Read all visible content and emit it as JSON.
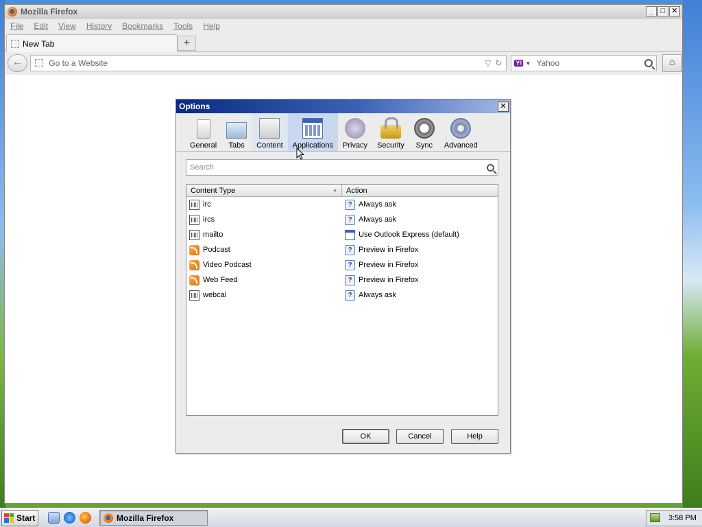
{
  "window": {
    "title": "Mozilla Firefox",
    "controls": {
      "minimize": "_",
      "maximize": "□",
      "close": "✕"
    }
  },
  "menubar": [
    "File",
    "Edit",
    "View",
    "History",
    "Bookmarks",
    "Tools",
    "Help"
  ],
  "tabs": [
    {
      "label": "New Tab"
    }
  ],
  "new_tab_button": "+",
  "navbar": {
    "url_placeholder": "Go to a Website",
    "search_engine": "Yahoo",
    "search_badge": "Y!"
  },
  "dialog": {
    "title": "Options",
    "close": "✕",
    "panes": [
      {
        "label": "General",
        "icon": "general-icon"
      },
      {
        "label": "Tabs",
        "icon": "tabs-icon"
      },
      {
        "label": "Content",
        "icon": "content-icon",
        "state": "hover"
      },
      {
        "label": "Applications",
        "icon": "applications-icon",
        "state": "selected"
      },
      {
        "label": "Privacy",
        "icon": "privacy-mask-icon"
      },
      {
        "label": "Security",
        "icon": "security-lock-icon"
      },
      {
        "label": "Sync",
        "icon": "sync-icon"
      },
      {
        "label": "Advanced",
        "icon": "advanced-gear-icon"
      }
    ],
    "search_placeholder": "Search",
    "columns": {
      "content_type": "Content Type",
      "action": "Action"
    },
    "rows": [
      {
        "type": "irc",
        "type_icon": "protocol",
        "action": "Always ask",
        "action_icon": "ask"
      },
      {
        "type": "ircs",
        "type_icon": "protocol",
        "action": "Always ask",
        "action_icon": "ask"
      },
      {
        "type": "mailto",
        "type_icon": "protocol",
        "action": "Use Outlook Express (default)",
        "action_icon": "app"
      },
      {
        "type": "Podcast",
        "type_icon": "feed",
        "action": "Preview in Firefox",
        "action_icon": "ask"
      },
      {
        "type": "Video Podcast",
        "type_icon": "feed",
        "action": "Preview in Firefox",
        "action_icon": "ask"
      },
      {
        "type": "Web Feed",
        "type_icon": "feed",
        "action": "Preview in Firefox",
        "action_icon": "ask"
      },
      {
        "type": "webcal",
        "type_icon": "protocol",
        "action": "Always ask",
        "action_icon": "ask"
      }
    ],
    "buttons": {
      "ok": "OK",
      "cancel": "Cancel",
      "help": "Help"
    }
  },
  "taskbar": {
    "start": "Start",
    "task": "Mozilla Firefox",
    "clock": "3:58 PM"
  },
  "colors": {
    "dialog_title_start": "#0b2a82",
    "dialog_title_end": "#a4bae3",
    "selected_pane": "#c9d8ee"
  }
}
